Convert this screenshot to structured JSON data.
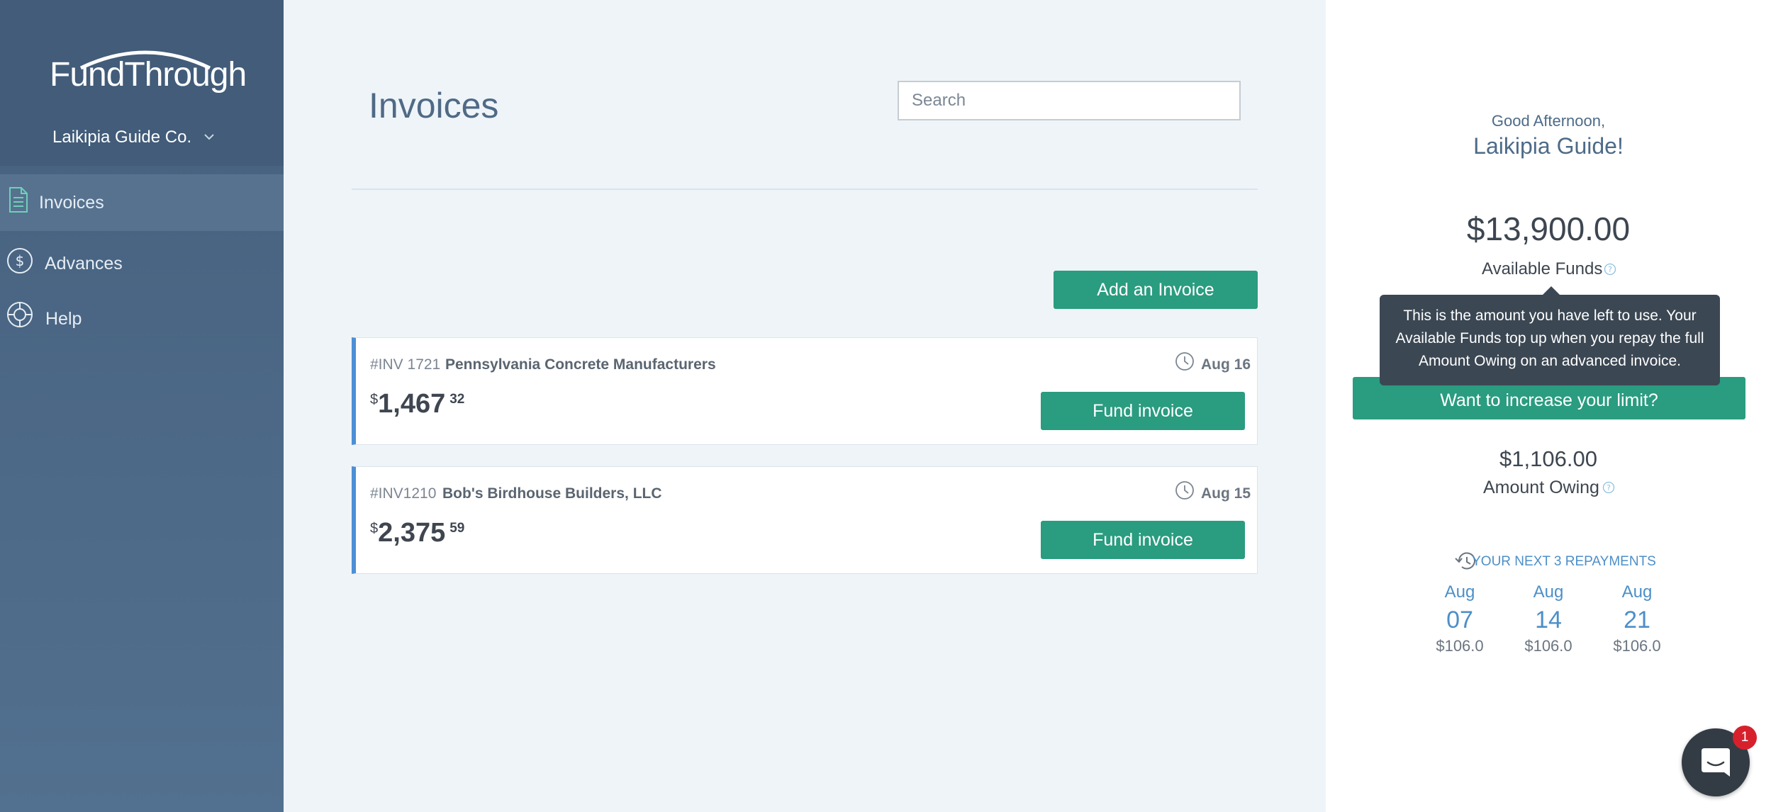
{
  "sidebar": {
    "logo": "FundThrough",
    "company": "Laikipia Guide Co.",
    "items": [
      {
        "label": "Invoices",
        "icon": "invoice-document-icon",
        "active": true
      },
      {
        "label": "Advances",
        "icon": "dollar-circle-icon",
        "active": false
      },
      {
        "label": "Help",
        "icon": "lifebuoy-icon",
        "active": false
      }
    ]
  },
  "main": {
    "title": "Invoices",
    "search_placeholder": "Search",
    "add_button": "Add an Invoice",
    "invoices": [
      {
        "number": "#INV 1721",
        "client": "Pennsylvania Concrete Manufacturers",
        "date": "Aug 16",
        "currency": "$",
        "whole": "1,467",
        "cents": "32",
        "action": "Fund invoice"
      },
      {
        "number": "#INV1210",
        "client": "Bob's Birdhouse Builders, LLC",
        "date": "Aug 15",
        "currency": "$",
        "whole": "2,375",
        "cents": "59",
        "action": "Fund invoice"
      }
    ]
  },
  "right": {
    "greeting_small": "Good Afternoon,",
    "greeting_name": "Laikipia Guide!",
    "available_amount": "$13,900.00",
    "available_label": "Available Funds",
    "tooltip": "This is the amount you have left to use. Your Available Funds top up when you repay the full Amount Owing on an advanced invoice.",
    "limit_button": "Want to increase your limit?",
    "owing_amount": "$1,106.00",
    "owing_label": "Amount Owing",
    "repayments_title": "YOUR NEXT 3 REPAYMENTS",
    "repayments": [
      {
        "month": "Aug",
        "day": "07",
        "amount": "$106.0"
      },
      {
        "month": "Aug",
        "day": "14",
        "amount": "$106.0"
      },
      {
        "month": "Aug",
        "day": "21",
        "amount": "$106.0"
      }
    ]
  },
  "chat": {
    "badge": "1"
  },
  "colors": {
    "accent": "#2a9c80",
    "sidebar": "#45607d",
    "highlight": "#4d8fd6"
  }
}
